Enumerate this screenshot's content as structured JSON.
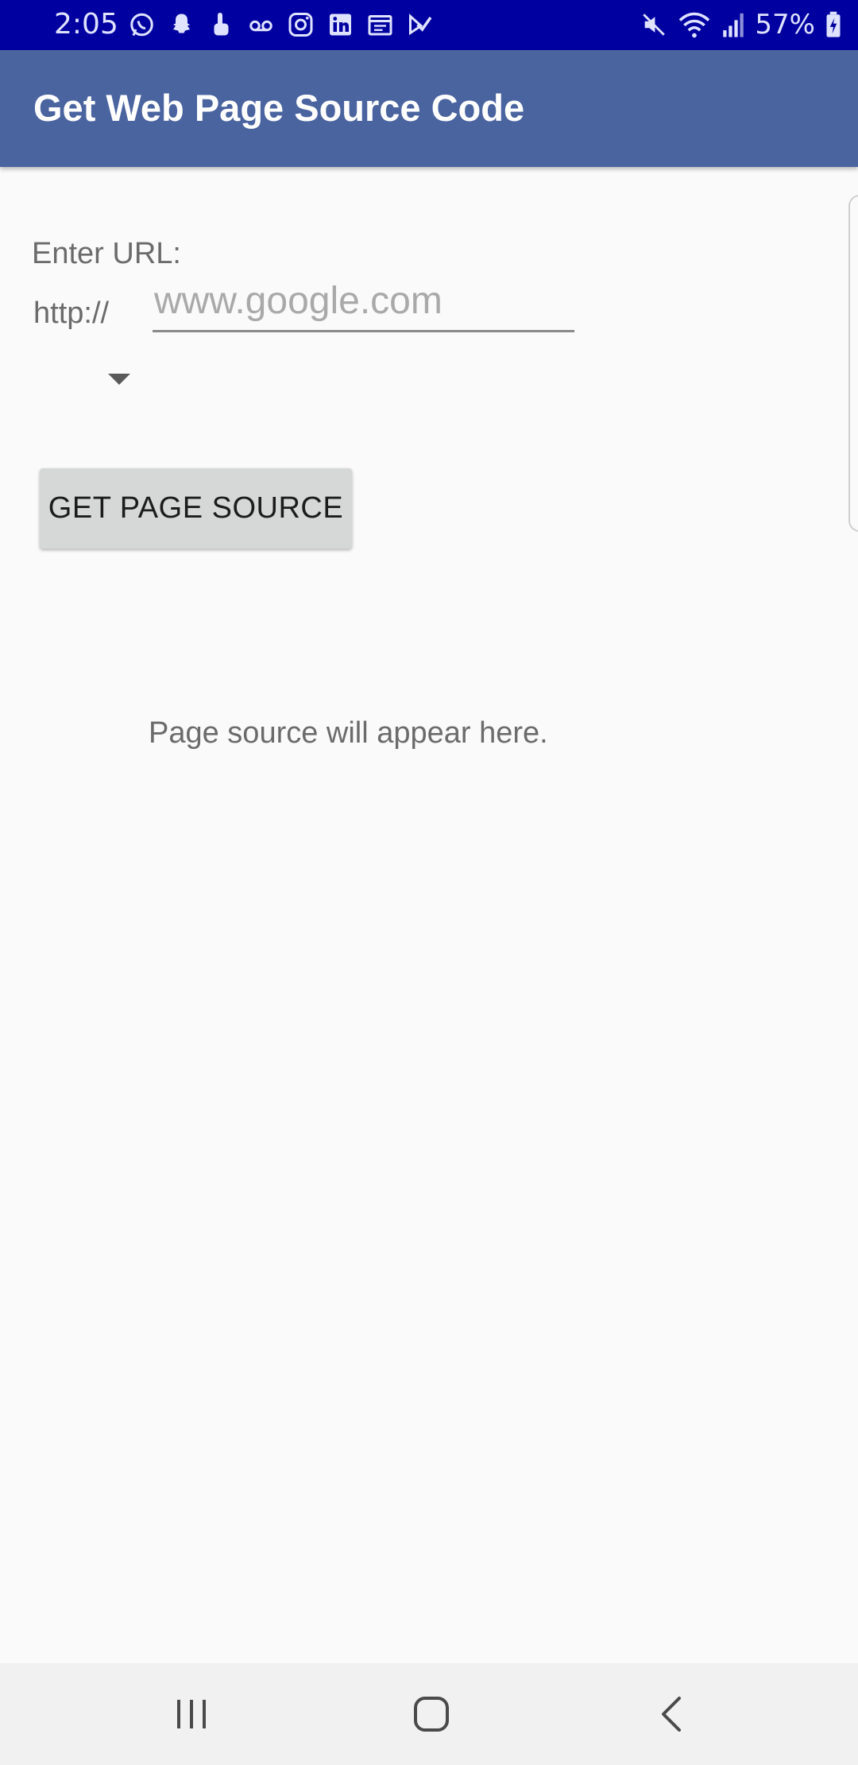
{
  "status_bar": {
    "time": "2:05",
    "battery": "57%",
    "notification_icons": [
      "whatsapp-icon",
      "snapchat-icon",
      "touch-icon",
      "voicemail-icon",
      "instagram-icon",
      "linkedin-icon",
      "calendar-icon",
      "checkmark-icon"
    ],
    "system_icons": [
      "mute-icon",
      "wifi-icon",
      "signal-icon",
      "battery-charging-icon"
    ]
  },
  "app_bar": {
    "title": "Get Web Page Source Code"
  },
  "form": {
    "url_label": "Enter URL:",
    "scheme": "http://",
    "url_placeholder": "www.google.com",
    "button_label": "GET PAGE SOURCE"
  },
  "result": {
    "text": "Page source will appear here."
  },
  "nav_bar": {
    "buttons": [
      "recent-apps-icon",
      "home-icon",
      "back-icon"
    ]
  },
  "colors": {
    "status_bar": "#0000a0",
    "app_bar": "#4a64a0",
    "background": "#fafafa",
    "button": "#d6d7d7"
  }
}
